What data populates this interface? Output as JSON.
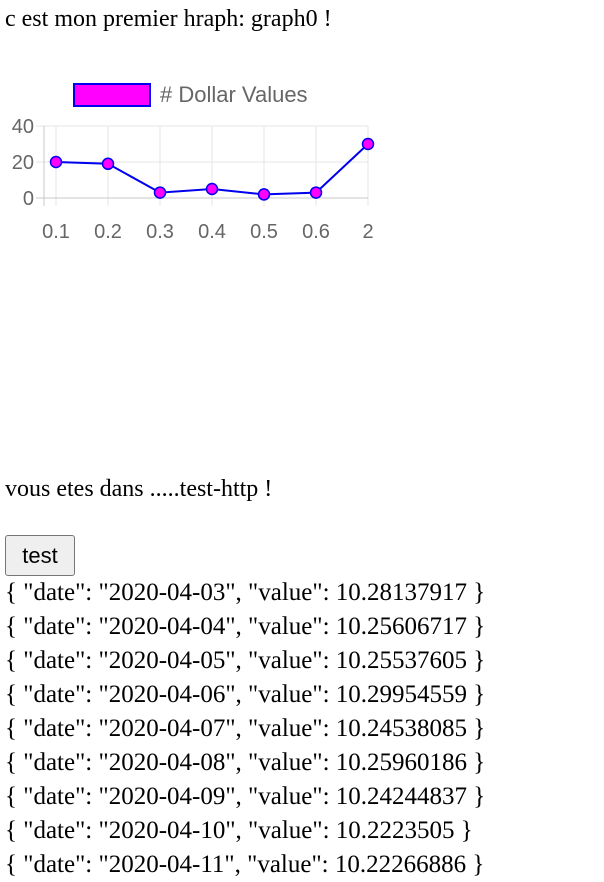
{
  "heading": "c est mon premier hraph: graph0 !",
  "chart_data": {
    "type": "line",
    "categories": [
      "0.1",
      "0.2",
      "0.3",
      "0.4",
      "0.5",
      "0.6",
      "2"
    ],
    "series": [
      {
        "name": "# Dollar Values",
        "values": [
          20,
          19,
          3,
          5,
          2,
          3,
          30
        ]
      }
    ],
    "yticks": [
      "40",
      "20",
      "0"
    ],
    "ylim": [
      0,
      40
    ],
    "legend": "top",
    "grid": true,
    "line_color": "#0000ee",
    "marker_color": "#ff00ff"
  },
  "subheading": "vous etes dans .....test-http !",
  "test_button_label": "test",
  "records": [
    "{ \"date\": \"2020-04-03\", \"value\": 10.28137917 }",
    "{ \"date\": \"2020-04-04\", \"value\": 10.25606717 }",
    "{ \"date\": \"2020-04-05\", \"value\": 10.25537605 }",
    "{ \"date\": \"2020-04-06\", \"value\": 10.29954559 }",
    "{ \"date\": \"2020-04-07\", \"value\": 10.24538085 }",
    "{ \"date\": \"2020-04-08\", \"value\": 10.25960186 }",
    "{ \"date\": \"2020-04-09\", \"value\": 10.24244837 }",
    "{ \"date\": \"2020-04-10\", \"value\": 10.2223505 }",
    "{ \"date\": \"2020-04-11\", \"value\": 10.22266886 }"
  ]
}
